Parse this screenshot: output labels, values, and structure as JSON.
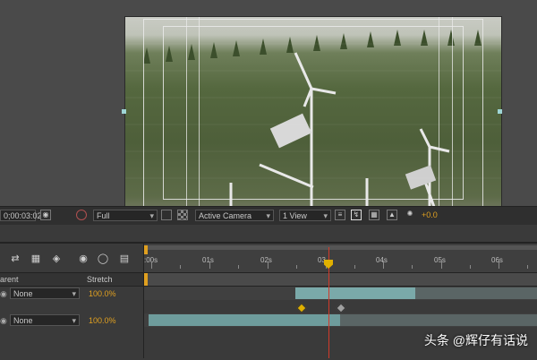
{
  "viewer": {
    "timecode": "0;00:03:02",
    "resolution": "Full",
    "view": "Active Camera",
    "layout": "1 View",
    "exposure": "+0.0"
  },
  "timeline": {
    "ruler_labels": [
      ":00s",
      "01s",
      "02s",
      "03",
      "04s",
      "05s",
      "06s"
    ],
    "columns": {
      "parent": "arent",
      "stretch": "Stretch"
    },
    "layers": [
      {
        "parent": "None",
        "stretch": "100.0%"
      },
      {
        "parent": "None",
        "stretch": "100.0%"
      }
    ]
  },
  "colors": {
    "accent": "#e0a020",
    "playhead": "#d23a2a",
    "bar": "#6e9c9c"
  },
  "watermark": "头条 @辉仔有话说"
}
